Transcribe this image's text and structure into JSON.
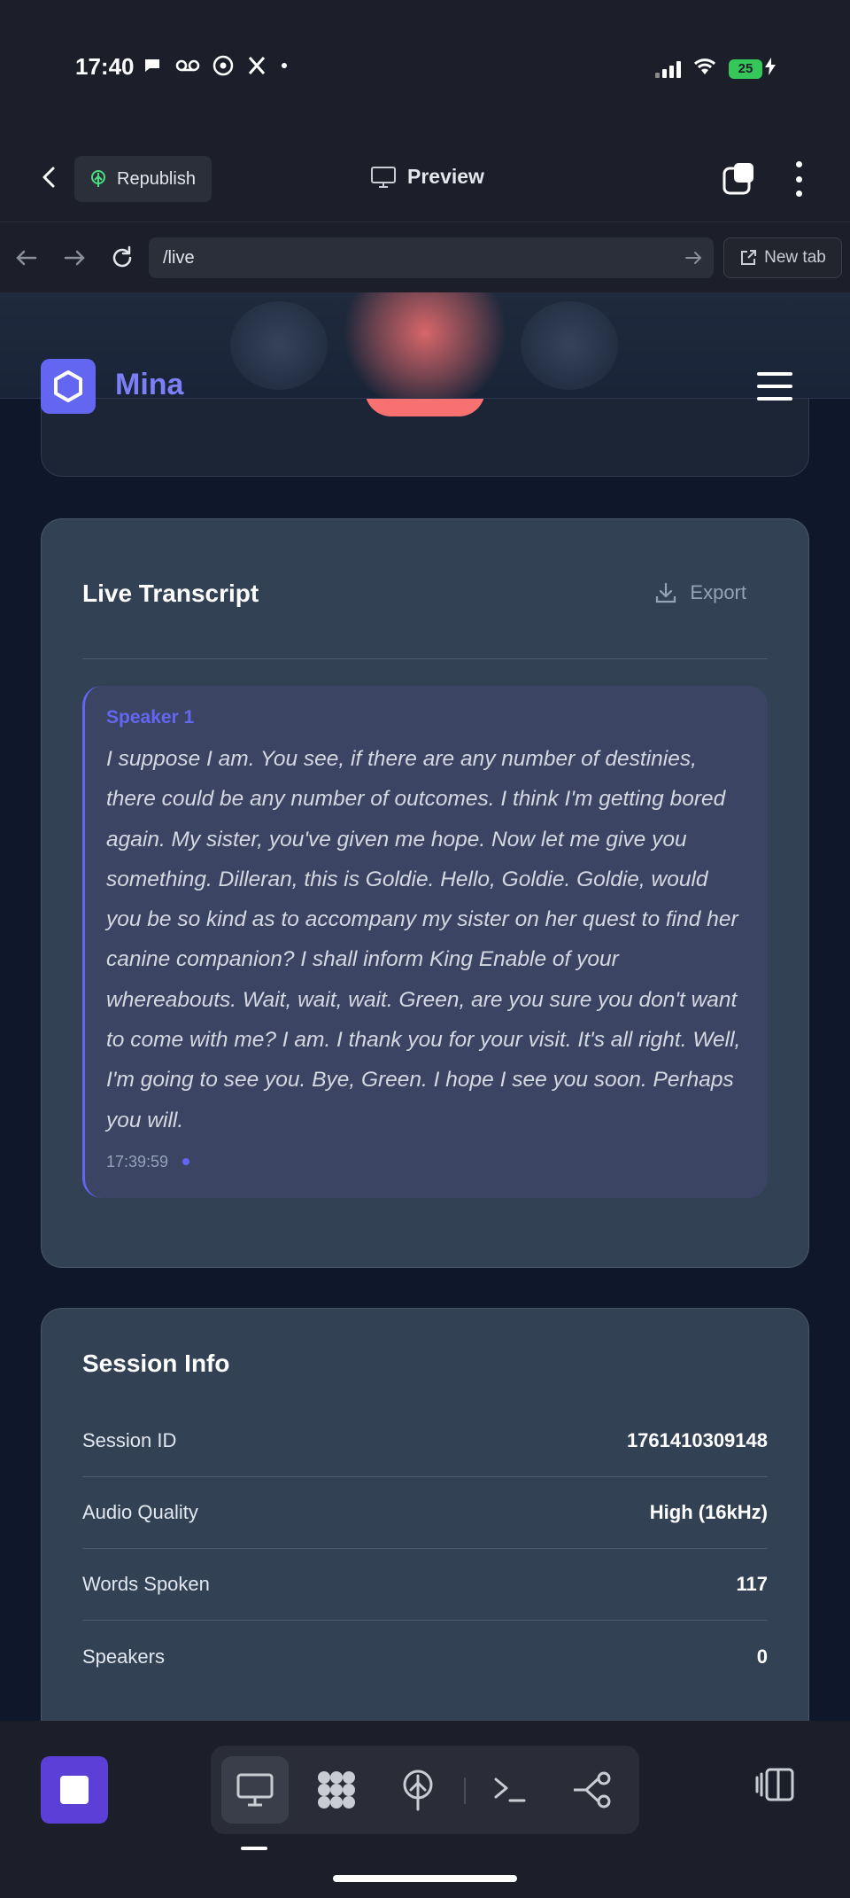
{
  "status_bar": {
    "time": "17:40",
    "battery": "25"
  },
  "app_bar": {
    "republish_label": "Republish",
    "preview_label": "Preview"
  },
  "browser": {
    "url": "/live",
    "new_tab_label": "New tab"
  },
  "site": {
    "brand": "Mina"
  },
  "transcript": {
    "title": "Live Transcript",
    "export_label": "Export",
    "entries": [
      {
        "speaker": "Speaker 1",
        "text": "I suppose I am. You see, if there are any number of destinies, there could be any number of outcomes. I think I'm getting bored again. My sister, you've given me hope. Now let me give you something. Dilleran, this is Goldie. Hello, Goldie. Goldie, would you be so kind as to accompany my sister on her quest to find her canine companion? I shall inform King Enable of your whereabouts. Wait, wait, wait. Green, are you sure you don't want to come with me? I am. I thank you for your visit. It's all right. Well, I'm going to see you. Bye, Green. I hope I see you soon. Perhaps you will.",
        "time": "17:39:59"
      }
    ]
  },
  "session_info": {
    "title": "Session Info",
    "rows": [
      {
        "label": "Session ID",
        "value": "1761410309148"
      },
      {
        "label": "Audio Quality",
        "value": "High (16kHz)"
      },
      {
        "label": "Words Spoken",
        "value": "117"
      },
      {
        "label": "Speakers",
        "value": "0"
      }
    ]
  },
  "colors": {
    "accent": "#6366f1",
    "record": "#f87171",
    "card": "#334155",
    "page_bg": "#0f172a"
  },
  "icons": {
    "bottom_tools": [
      "monitor-icon",
      "grid-blobs-icon",
      "deploy-icon",
      "terminal-icon",
      "share-nodes-icon"
    ]
  }
}
